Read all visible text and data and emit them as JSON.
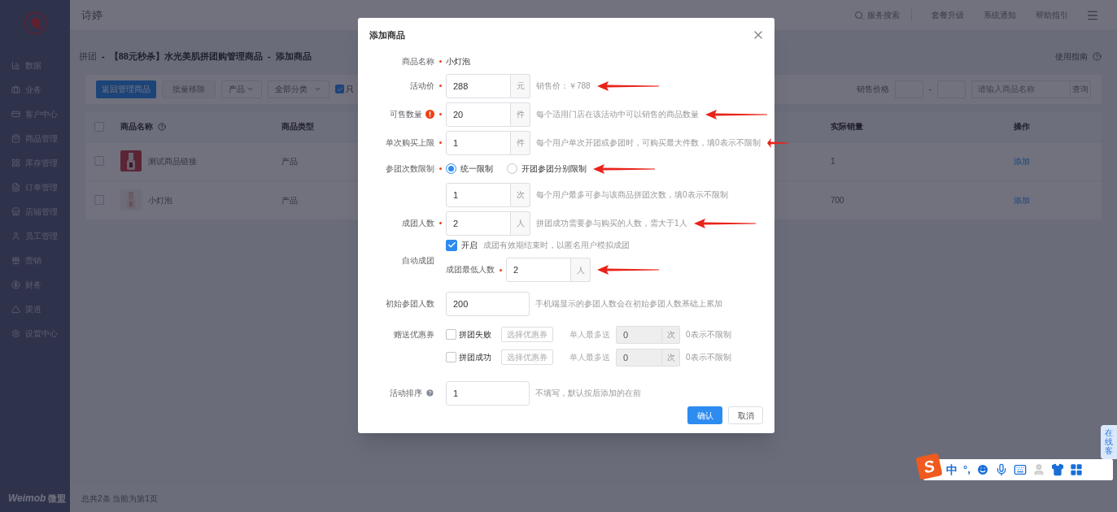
{
  "header": {
    "title": "诗婷",
    "search": "服务搜索",
    "links": [
      "套餐升级",
      "系统通知",
      "帮助指引"
    ]
  },
  "sidebar": {
    "items": [
      {
        "label": "数据"
      },
      {
        "label": "业务"
      },
      {
        "label": "客户中心"
      },
      {
        "label": "商品管理"
      },
      {
        "label": "库存管理"
      },
      {
        "label": "订单管理"
      },
      {
        "label": "店铺管理"
      },
      {
        "label": "员工管理"
      },
      {
        "label": "营销"
      },
      {
        "label": "财务"
      },
      {
        "label": "渠道"
      },
      {
        "label": "设置中心"
      }
    ],
    "brand": "Weimob",
    "brand_cn": "微盟"
  },
  "breadcrumb": {
    "items": [
      "拼团",
      "【88元秒杀】水光美肌拼团购管理商品",
      "添加商品"
    ],
    "separator": "-"
  },
  "guide_link": "使用指南",
  "toolbar": {
    "back_button": "返回管理商品",
    "remove_button": {
      "label": "批量移除",
      "disabled": true
    },
    "selects": [
      "产品",
      "全部分类"
    ],
    "only_checkbox": {
      "label": "只",
      "checked": true
    },
    "price_label": "销售价格",
    "range_separator": "-",
    "search_placeholder": "请输入商品名称",
    "search_button": "查询"
  },
  "table": {
    "header_checked": false,
    "columns": [
      "商品名称",
      "商品类型",
      "实际销量",
      "操作"
    ],
    "rows": [
      {
        "checked": false,
        "name": "测试商品链接",
        "type": "产品",
        "sales": "1",
        "action": "添加"
      },
      {
        "checked": false,
        "name": "小灯泡",
        "type": "产品",
        "sales": "700",
        "action": "添加"
      }
    ]
  },
  "footer": "总共2条 当前为第1页",
  "modal": {
    "title": "添加商品",
    "fields": [
      {
        "kind": "text",
        "label": "商品名称",
        "required": true,
        "value": "小灯泡"
      },
      {
        "kind": "input",
        "label": "活动价",
        "required": true,
        "value": "288",
        "unit": "元",
        "hint": "销售价：￥788",
        "arrow": true
      },
      {
        "kind": "input",
        "label": "可售数量",
        "required": true,
        "warning": true,
        "value": "20",
        "unit": "件",
        "hint": "每个适用门店在该活动中可以销售的商品数量",
        "arrow": true
      },
      {
        "kind": "input",
        "label": "单次购买上限",
        "required": true,
        "value": "1",
        "unit": "件",
        "hint": "每个用户单次开团或参团时，可购买最大件数，填0表示不限制",
        "arrow": true
      },
      {
        "kind": "radio",
        "label": "参团次数限制",
        "required": true,
        "options": [
          {
            "label": "统一限制",
            "selected": true
          },
          {
            "label": "开团参团分别限制",
            "selected": false
          }
        ],
        "arrow": true
      },
      {
        "kind": "input",
        "value": "1",
        "unit": "次",
        "hint": "每个用户最多可参与该商品拼团次数，填0表示不限制",
        "arrow": false
      },
      {
        "kind": "input",
        "label": "成团人数",
        "required": true,
        "value": "2",
        "unit": "人",
        "hint": "拼团成功需要参与购买的人数，需大于1人",
        "arrow": true
      },
      {
        "kind": "auto",
        "label": "自动成团",
        "checkbox": {
          "label": "开启",
          "checked": true
        },
        "note": "成团有效期结束时，以匿名用户模拟成团",
        "sub_label": "成团最低人数",
        "required": true,
        "value": "2",
        "unit": "人",
        "arrow": true
      },
      {
        "kind": "input",
        "label": "初始参团人数",
        "required": false,
        "value": "200",
        "hint": "手机端显示的参团人数会在初始参团人数基础上累加",
        "arrow": false
      },
      {
        "kind": "coupon",
        "label": "赠送优惠券",
        "rows": [
          {
            "label": "拼团失败",
            "checked": false,
            "picker": "选择优惠券",
            "limit_label": "单人最多送",
            "value": "0",
            "unit": "次",
            "disabled": true,
            "hint": "0表示不限制"
          },
          {
            "label": "拼团成功",
            "checked": false,
            "picker": "选择优惠券",
            "limit_label": "单人最多送",
            "value": "0",
            "unit": "次",
            "disabled": true,
            "hint": "0表示不限制"
          }
        ]
      },
      {
        "kind": "input",
        "label": "活动排序",
        "help": true,
        "required": false,
        "value": "1",
        "hint": "不填写，默认按后添加的在前",
        "arrow": false
      }
    ],
    "confirm": "确认",
    "cancel": "取消"
  },
  "ime": {
    "logo": "S",
    "mode": "中",
    "punct": "°,"
  },
  "service_tab": "在线客"
}
